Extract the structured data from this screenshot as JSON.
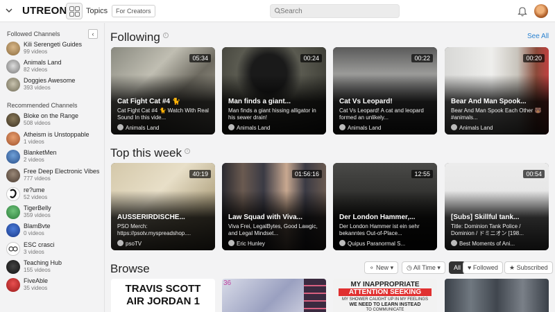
{
  "header": {
    "logo_text": "UTREON",
    "topics_label": "Topics",
    "creators_label": "For Creators",
    "search_placeholder": "Search",
    "accent_color": "#2a8fd6"
  },
  "sidebar": {
    "followed_heading": "Followed Channels",
    "followed": [
      {
        "name": "Kili Serengeti Guides",
        "count": "99 videos"
      },
      {
        "name": "Animals Land",
        "count": "82 videos"
      },
      {
        "name": "Doggies Awesome",
        "count": "393 videos"
      }
    ],
    "recommended_heading": "Recommended Channels",
    "recommended": [
      {
        "name": "Bloke on the Range",
        "count": "508 videos"
      },
      {
        "name": "Atheism is Unstoppable",
        "count": "1 videos"
      },
      {
        "name": "BlanketMen",
        "count": "2 videos"
      },
      {
        "name": "Free Deep Electronic Vibes",
        "count": "777 videos"
      },
      {
        "name": "re?ume",
        "count": "52 videos"
      },
      {
        "name": "TigerBelly",
        "count": "359 videos"
      },
      {
        "name": "BlamBvte",
        "count": "0 videos"
      },
      {
        "name": "ESC crasci",
        "count": "3 videos"
      },
      {
        "name": "Teaching Hub",
        "count": "155 videos"
      },
      {
        "name": "FiveAble",
        "count": "35 videos"
      }
    ]
  },
  "following": {
    "title": "Following",
    "see_all": "See All",
    "videos": [
      {
        "duration": "05:34",
        "title": "Cat Fight Cat #4 🐈",
        "desc": "Cat Fight Cat #4 🐈 Watch With Real Sound In this vide...",
        "channel": "Animals Land"
      },
      {
        "duration": "00:24",
        "title": "Man finds a giant...",
        "desc": "Man finds a giant hissing alligator in his sewer drain!",
        "channel": "Animals Land"
      },
      {
        "duration": "00:22",
        "title": "Cat Vs Leopard!",
        "desc": "Cat Vs Leopard! A cat and leopard formed an unlikely...",
        "channel": "Animals Land"
      },
      {
        "duration": "00:20",
        "title": "Bear And Man Spook...",
        "desc": "Bear And Man Spook Each Other 🐻 #animals...",
        "channel": "Animals Land"
      }
    ]
  },
  "top_week": {
    "title": "Top this week",
    "videos": [
      {
        "duration": "40:19",
        "title": "AUSSERIRDISCHE...",
        "desc": "PSO Merch: https://psotv.myspreadshop....",
        "channel": "psoTV"
      },
      {
        "duration": "01:56:16",
        "title": "Law Squad with Viva...",
        "desc": "Viva Frei, LegalBytes, Good Lawgic, and Legal Mindset...",
        "channel": "Eric Hunley"
      },
      {
        "duration": "12:55",
        "title": "Der London Hammer,...",
        "desc": "Der London Hammer ist ein sehr bekanntes Out-of-Place...",
        "channel": "Quipus Paranormal S..."
      },
      {
        "duration": "00:54",
        "title": "[Subs] Skillful tank...",
        "desc": "Title: Dominion Tank Police / Dominion / ドミニオン [198...",
        "channel": "Best Moments of Ani..."
      }
    ]
  },
  "browse": {
    "title": "Browse",
    "filters": {
      "new": "New",
      "all_time": "All Time",
      "all": "All",
      "followed": "Followed",
      "subscribed": "Subscribed"
    },
    "thumb_texts": [
      "TRAVIS SCOTT",
      "AIR JORDAN 1",
      "36",
      "MY INAPPROPRIATE",
      "ATTENTION SEEKING",
      "MY SHOWER CAUGHT UP IN MY FEELINGS",
      "WE NEED TO LEARN INSTEAD",
      "TO COMMUNICATE"
    ]
  }
}
